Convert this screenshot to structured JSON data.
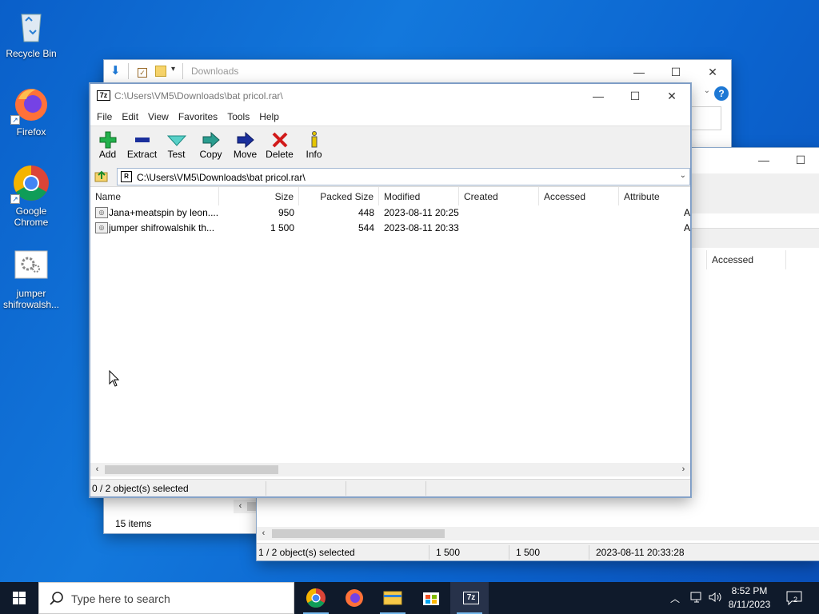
{
  "desktop": {
    "icons": [
      {
        "label": "Recycle Bin"
      },
      {
        "label": "Firefox"
      },
      {
        "label": "Google Chrome"
      },
      {
        "label": "jumper shifrowalsh..."
      }
    ]
  },
  "explorer_window": {
    "title": "Downloads",
    "status_items": "15 items"
  },
  "second_window": {
    "col_accessed": "Accessed",
    "status": {
      "selected": "1 / 2 object(s) selected",
      "size": "1 500",
      "packed": "1 500",
      "modified": "2023-08-11 20:33:28"
    }
  },
  "zip_window": {
    "title": "C:\\Users\\VM5\\Downloads\\bat pricol.rar\\",
    "logo": "7z",
    "menu": [
      "File",
      "Edit",
      "View",
      "Favorites",
      "Tools",
      "Help"
    ],
    "toolbar": [
      {
        "label": "Add",
        "icon": "plus-icon"
      },
      {
        "label": "Extract",
        "icon": "minus-icon"
      },
      {
        "label": "Test",
        "icon": "check-icon"
      },
      {
        "label": "Copy",
        "icon": "copy-arrow-icon"
      },
      {
        "label": "Move",
        "icon": "move-arrow-icon"
      },
      {
        "label": "Delete",
        "icon": "delete-x-icon"
      },
      {
        "label": "Info",
        "icon": "info-icon"
      }
    ],
    "address": "C:\\Users\\VM5\\Downloads\\bat pricol.rar\\",
    "columns": [
      "Name",
      "Size",
      "Packed Size",
      "Modified",
      "Created",
      "Accessed",
      "Attribute"
    ],
    "rows": [
      {
        "name": "Jana+meatspin by leon....",
        "size": "950",
        "packed": "448",
        "modified": "2023-08-11 20:25",
        "created": "",
        "accessed": "",
        "attr": "A"
      },
      {
        "name": "jumper shifrowalshik th...",
        "size": "1 500",
        "packed": "544",
        "modified": "2023-08-11 20:33",
        "created": "",
        "accessed": "",
        "attr": "A"
      }
    ],
    "status": {
      "selected": "0 / 2 object(s) selected"
    }
  },
  "taskbar": {
    "search_placeholder": "Type here to search",
    "apps": [
      "chrome-icon",
      "firefox-icon",
      "file-explorer-icon",
      "store-icon",
      "7zip-icon"
    ],
    "time": "8:52 PM",
    "date": "8/11/2023",
    "notifications": "2"
  },
  "colors": {
    "desktop_blue": "#0b64cf",
    "taskbar": "#0f1a2b",
    "add_green": "#22b14c",
    "extract_blue": "#1a2f9c",
    "delete_red": "#d11a1a"
  }
}
